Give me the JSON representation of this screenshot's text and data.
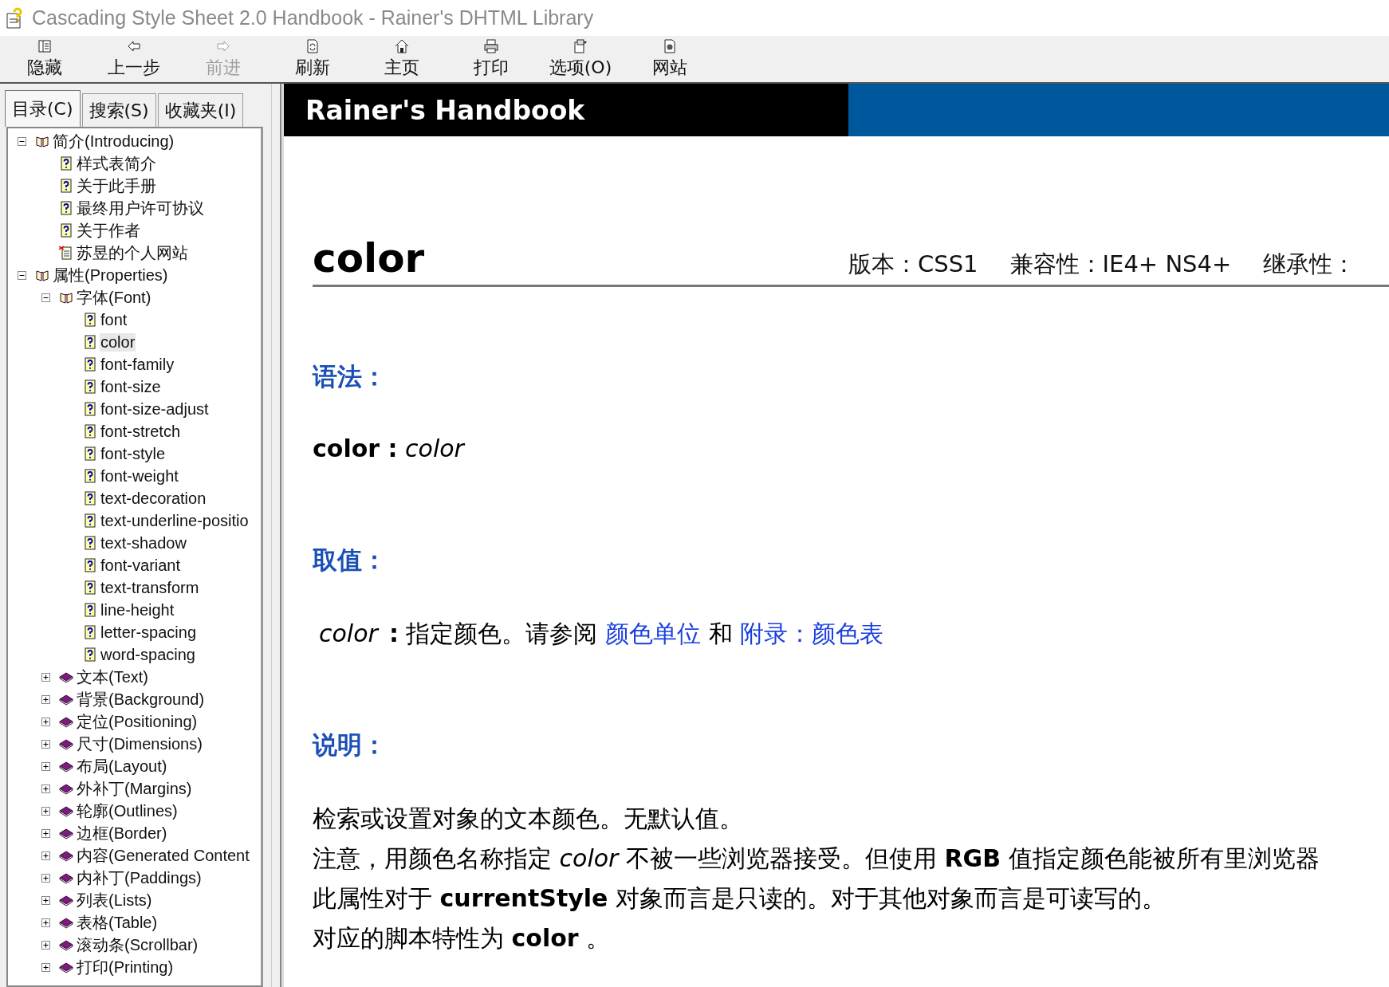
{
  "window": {
    "title": "Cascading Style Sheet 2.0 Handbook - Rainer's DHTML Library"
  },
  "toolbar": [
    {
      "label": "隐藏",
      "kind": "hide",
      "disabled": false
    },
    {
      "label": "上一步",
      "kind": "back",
      "disabled": false
    },
    {
      "label": "前进",
      "kind": "forward",
      "disabled": true
    },
    {
      "label": "刷新",
      "kind": "refresh",
      "disabled": false
    },
    {
      "label": "主页",
      "kind": "home",
      "disabled": false
    },
    {
      "label": "打印",
      "kind": "print",
      "disabled": false
    },
    {
      "label": "选项(O)",
      "kind": "options",
      "disabled": false
    },
    {
      "label": "网站",
      "kind": "web",
      "disabled": false
    }
  ],
  "nav_tabs": [
    {
      "label": "目录(C)",
      "selected": true
    },
    {
      "label": "搜索(S)",
      "selected": false
    },
    {
      "label": "收藏夹(I)",
      "selected": false
    }
  ],
  "tree": [
    {
      "label": "简介(Introducing)",
      "kind": "folder",
      "expanded": true,
      "selected": false,
      "children": [
        {
          "label": "样式表简介",
          "kind": "page",
          "selected": false
        },
        {
          "label": "关于此手册",
          "kind": "page",
          "selected": false
        },
        {
          "label": "最终用户许可协议",
          "kind": "page",
          "selected": false
        },
        {
          "label": "关于作者",
          "kind": "page",
          "selected": false
        },
        {
          "label": "苏昱的个人网站",
          "kind": "link",
          "selected": false
        }
      ]
    },
    {
      "label": "属性(Properties)",
      "kind": "folder",
      "expanded": true,
      "selected": false,
      "children": [
        {
          "label": "字体(Font)",
          "kind": "folder",
          "expanded": true,
          "selected": false,
          "children": [
            {
              "label": "font",
              "kind": "page",
              "selected": false
            },
            {
              "label": "color",
              "kind": "page",
              "selected": true
            },
            {
              "label": "font-family",
              "kind": "page",
              "selected": false
            },
            {
              "label": "font-size",
              "kind": "page",
              "selected": false
            },
            {
              "label": "font-size-adjust",
              "kind": "page",
              "selected": false
            },
            {
              "label": "font-stretch",
              "kind": "page",
              "selected": false
            },
            {
              "label": "font-style",
              "kind": "page",
              "selected": false
            },
            {
              "label": "font-weight",
              "kind": "page",
              "selected": false
            },
            {
              "label": "text-decoration",
              "kind": "page",
              "selected": false
            },
            {
              "label": "text-underline-positio",
              "kind": "page",
              "selected": false
            },
            {
              "label": "text-shadow",
              "kind": "page",
              "selected": false
            },
            {
              "label": "font-variant",
              "kind": "page",
              "selected": false
            },
            {
              "label": "text-transform",
              "kind": "page",
              "selected": false
            },
            {
              "label": "line-height",
              "kind": "page",
              "selected": false
            },
            {
              "label": "letter-spacing",
              "kind": "page",
              "selected": false
            },
            {
              "label": "word-spacing",
              "kind": "page",
              "selected": false
            }
          ]
        },
        {
          "label": "文本(Text)",
          "kind": "folder",
          "expanded": false,
          "selected": false
        },
        {
          "label": "背景(Background)",
          "kind": "folder",
          "expanded": false,
          "selected": false
        },
        {
          "label": "定位(Positioning)",
          "kind": "folder",
          "expanded": false,
          "selected": false
        },
        {
          "label": "尺寸(Dimensions)",
          "kind": "folder",
          "expanded": false,
          "selected": false
        },
        {
          "label": "布局(Layout)",
          "kind": "folder",
          "expanded": false,
          "selected": false
        },
        {
          "label": "外补丁(Margins)",
          "kind": "folder",
          "expanded": false,
          "selected": false
        },
        {
          "label": "轮廓(Outlines)",
          "kind": "folder",
          "expanded": false,
          "selected": false
        },
        {
          "label": "边框(Border)",
          "kind": "folder",
          "expanded": false,
          "selected": false
        },
        {
          "label": "内容(Generated Content",
          "kind": "folder",
          "expanded": false,
          "selected": false
        },
        {
          "label": "内补丁(Paddings)",
          "kind": "folder",
          "expanded": false,
          "selected": false
        },
        {
          "label": "列表(Lists)",
          "kind": "folder",
          "expanded": false,
          "selected": false
        },
        {
          "label": "表格(Table)",
          "kind": "folder",
          "expanded": false,
          "selected": false
        },
        {
          "label": "滚动条(Scrollbar)",
          "kind": "folder",
          "expanded": false,
          "selected": false
        },
        {
          "label": "打印(Printing)",
          "kind": "folder",
          "expanded": false,
          "selected": false
        }
      ]
    }
  ],
  "content": {
    "banner": "Rainer's Handbook",
    "title": "color",
    "meta": [
      "版本：CSS1",
      "兼容性：IE4+ NS4+",
      "继承性："
    ],
    "sections": [
      {
        "heading": "语法：",
        "kind": "syntax",
        "lines": [
          "**color :** *color*"
        ]
      },
      {
        "heading": "取值：",
        "kind": "values",
        "parts": [
          {
            "kind": "term",
            "text": "color"
          },
          {
            "kind": "text",
            "text": "**:** 指定颜色。请参阅"
          },
          {
            "kind": "link",
            "text": "颜色单位"
          },
          {
            "kind": "text",
            "text": "和"
          },
          {
            "kind": "link",
            "text": "附录：颜色表"
          }
        ]
      },
      {
        "heading": "说明：",
        "kind": "description",
        "lines": [
          "检索或设置对象的文本颜色。无默认值。",
          "注意，用颜色名称指定 *color* 不被一些浏览器接受。但使用 **RGB** 值指定颜色能被所有里浏览器",
          "此属性对于 **currentStyle** 对象而言是只读的。对于其他对象而言是可读写的。",
          "对应的脚本特性为 **color** 。"
        ]
      }
    ]
  }
}
